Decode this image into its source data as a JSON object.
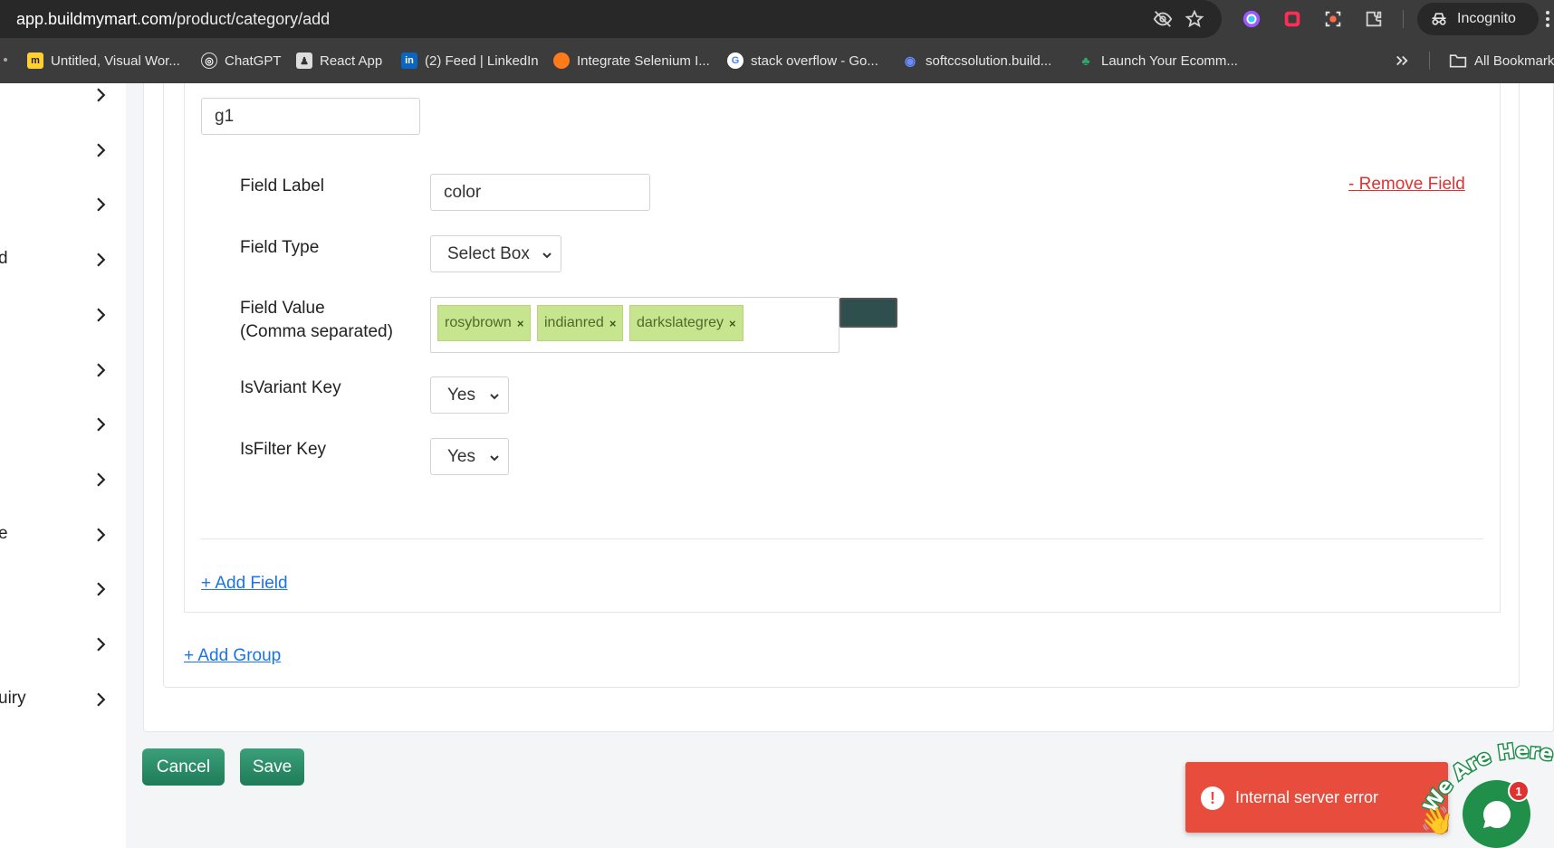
{
  "browser": {
    "url_host": "app.buildmymart.com",
    "url_path": "/product/category/add",
    "profile_label": "Incognito",
    "bookmarks": [
      {
        "label": "Untitled, Visual Wor...",
        "icon": "miro-icon"
      },
      {
        "label": "ChatGPT",
        "icon": "chatgpt-icon"
      },
      {
        "label": "React App",
        "icon": "react-app-icon"
      },
      {
        "label": "(2) Feed | LinkedIn",
        "icon": "linkedin-icon"
      },
      {
        "label": "Integrate Selenium I...",
        "icon": "firefox-icon"
      },
      {
        "label": "stack overflow - Go...",
        "icon": "google-icon"
      },
      {
        "label": "softccsolution.build...",
        "icon": "globe-icon"
      },
      {
        "label": "Launch Your Ecomm...",
        "icon": "shop-icon"
      }
    ],
    "all_bookmarks_label": "All Bookmarks"
  },
  "sidebar": {
    "fragments": [
      "d",
      "e",
      "uiry"
    ]
  },
  "group": {
    "name_value": "g1"
  },
  "field": {
    "label_label": "Field Label",
    "label_value": "color",
    "type_label": "Field Type",
    "type_value": "Select Box",
    "value_label_line1": "Field Value",
    "value_label_line2": "(Comma separated)",
    "tags": [
      "rosybrown",
      "indianred",
      "darkslategrey"
    ],
    "tag_remove_glyph": "×",
    "swatch_color": "#2f4f4f",
    "variant_label": "IsVariant Key",
    "variant_value": "Yes",
    "filter_label": "IsFilter Key",
    "filter_value": "Yes",
    "remove_label": "- Remove Field"
  },
  "actions": {
    "add_field": "+ Add Field",
    "add_group": "+ Add Group",
    "cancel": "Cancel",
    "save": "Save"
  },
  "toast": {
    "icon": "!",
    "message": "Internal server error"
  },
  "chat": {
    "tagline": "We Are Here!",
    "badge_count": "1"
  },
  "colors": {
    "primary_green": "#2a8a66",
    "toast_red": "#e84c3d",
    "link_blue": "#1a73e8",
    "link_red": "#e03131",
    "tag_bg": "#c6e58e"
  }
}
